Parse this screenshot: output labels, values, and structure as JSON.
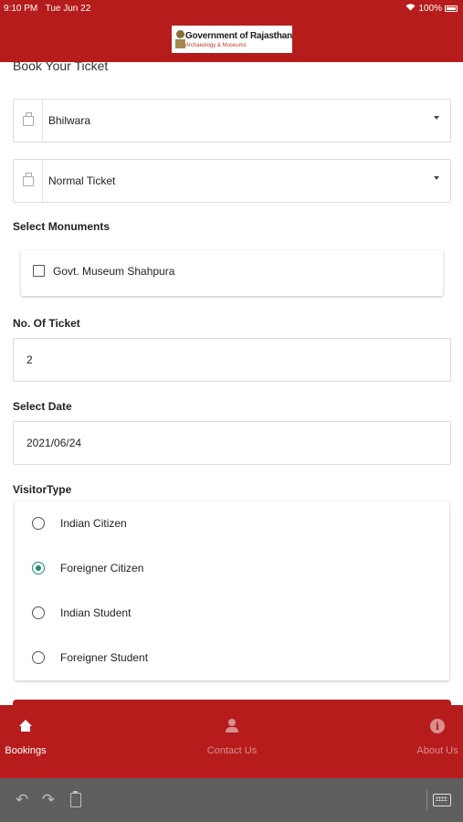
{
  "status_bar": {
    "time": "9:10 PM",
    "date": "Tue Jun 22",
    "wifi_icon": "wifi-icon",
    "battery": "100%"
  },
  "header": {
    "logo_title": "Government of Rajasthan",
    "logo_subtitle": "Archaeology & Museums",
    "bg_color": "#b71c1c"
  },
  "form": {
    "title": "Book Your Ticket",
    "district": {
      "value": "Bhilwara",
      "icon": "bag-icon"
    },
    "ticket_type": {
      "value": "Normal Ticket",
      "icon": "bag-icon"
    },
    "monuments_label": "Select Monuments",
    "monuments": [
      {
        "label": "Govt. Museum Shahpura",
        "checked": false
      }
    ],
    "tickets_label": "No. Of Ticket",
    "tickets_value": "2",
    "date_label": "Select Date",
    "date_value": "2021/06/24",
    "visitor_label": "VisitorType",
    "visitor_types": [
      {
        "label": "Indian Citizen",
        "selected": false
      },
      {
        "label": "Foreigner Citizen",
        "selected": true
      },
      {
        "label": "Indian Student",
        "selected": false
      },
      {
        "label": "Foreigner Student",
        "selected": false
      }
    ],
    "accent_color": "#1e8c6e"
  },
  "tabbar": {
    "tabs": [
      {
        "label": "Bookings",
        "icon": "home-icon",
        "active": true
      },
      {
        "label": "Contact Us",
        "icon": "person-icon",
        "active": false
      },
      {
        "label": "About Us",
        "icon": "info-icon",
        "active": false
      }
    ]
  },
  "keyboard_bar": {
    "icons": [
      "undo-icon",
      "redo-icon",
      "clipboard-icon",
      "keyboard-icon"
    ]
  }
}
